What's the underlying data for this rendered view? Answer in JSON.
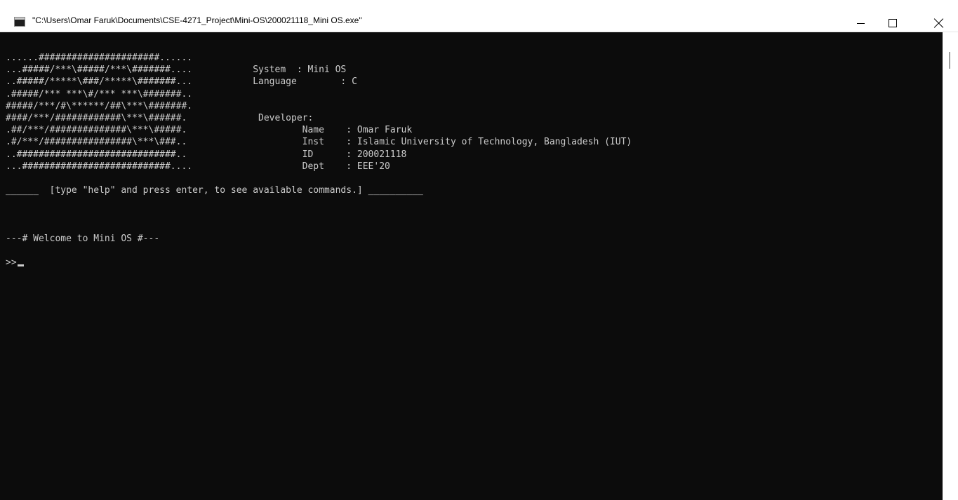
{
  "window": {
    "title": "\"C:\\Users\\Omar Faruk\\Documents\\CSE-4271_Project\\Mini-OS\\200021118_Mini OS.exe\""
  },
  "console": {
    "lines": [
      "......######################......",
      "...#####/***\\#####/***\\#######....           System  : Mini OS",
      "..#####/*****\\###/*****\\#######...           Language        : C",
      ".#####/*** ***\\#/*** ***\\#######..",
      "#####/***/#\\******/##\\***\\#######.",
      "####/***/############\\***\\######.             Developer:",
      ".##/***/##############\\***\\#####.                     Name    : Omar Faruk",
      ".#/***/################\\***\\###..                     Inst    : Islamic University of Technology, Bangladesh (IUT)",
      "..#############################..                     ID      : 200021118",
      "...###########################....                    Dept    : EEE'20",
      "",
      "______  [type \"help\" and press enter, to see available commands.] __________",
      "",
      "",
      "",
      "---# Welcome to Mini OS #---",
      "",
      ">>"
    ]
  }
}
